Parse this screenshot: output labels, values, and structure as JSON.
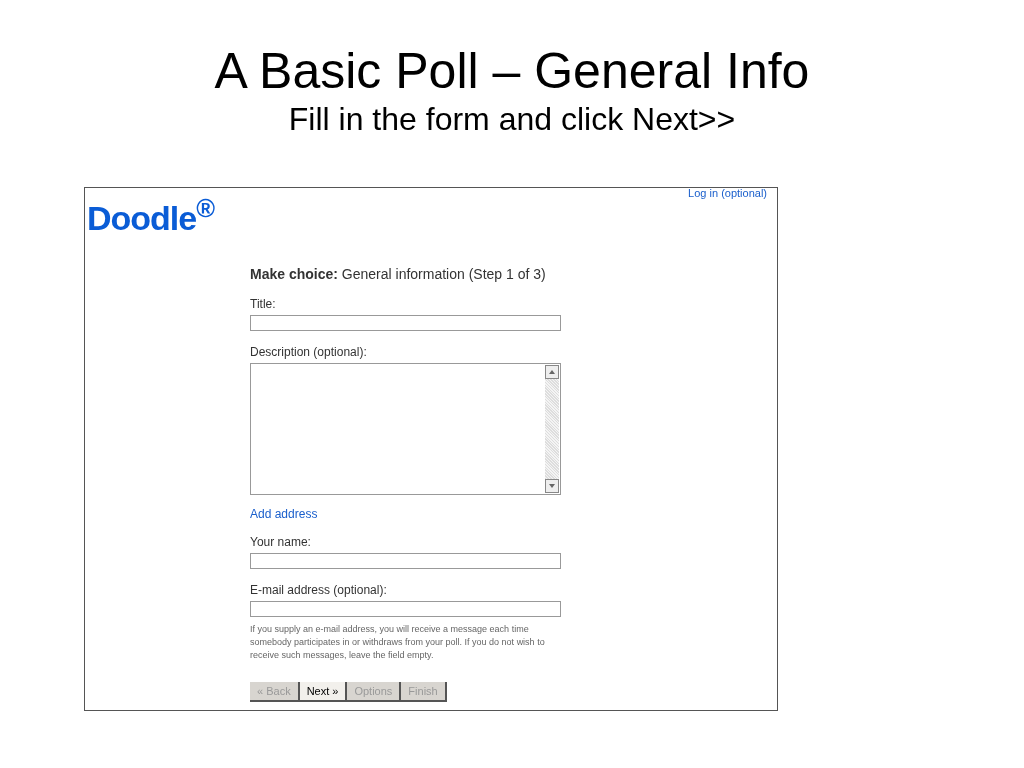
{
  "slide": {
    "title": "A Basic Poll – General Info",
    "subtitle": "Fill in the form and click Next>>"
  },
  "screenshot": {
    "logo": "Doodle$^{®}$",
    "login_link": "Log in (optional)",
    "heading": "**Make choice:** General information (Step 1 of 3)",
    "fields": [
      {
        "kind": "input",
        "label": "Title:"
      },
      {
        "kind": "textarea",
        "label": "Description (optional):"
      },
      {
        "kind": "link",
        "label": "Add address"
      },
      {
        "kind": "input",
        "label": "Your name:"
      },
      {
        "kind": "input",
        "label": "E-mail address (optional):"
      }
    ],
    "help_text": "If you supply an e-mail address, you will receive a message each time somebody participates in or withdraws from your poll. If you do not wish to receive such messages, leave the field empty.",
    "buttons": [
      {
        "label": "« Back",
        "disabled": true
      },
      {
        "label": "Next »",
        "disabled": false
      },
      {
        "label": "Options",
        "disabled": true
      },
      {
        "label": "Finish",
        "disabled": true
      }
    ]
  }
}
